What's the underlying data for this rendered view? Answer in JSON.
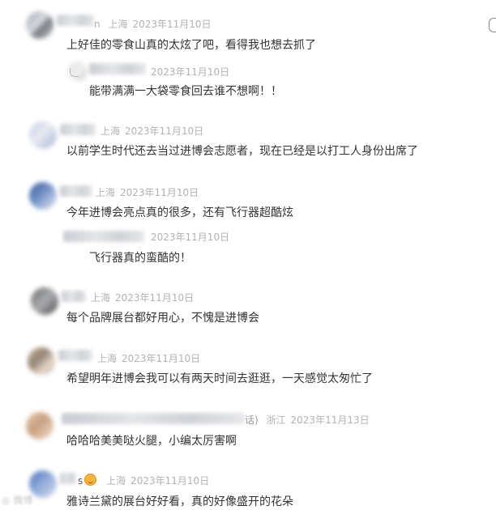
{
  "comments": [
    {
      "location": "上海",
      "date": "2023年11月10日",
      "name_suffix": "n",
      "text": "上好佳的零食山真的太炫了吧，看得我也想去抓了",
      "reply": {
        "date": "2023年11月10日",
        "text": "能带满满一大袋零食回去谁不想啊！！"
      }
    },
    {
      "location": "上海",
      "date": "2023年11月10日",
      "text": "以前学生时代还去当过进博会志愿者，现在已经是以打工人身份出席了"
    },
    {
      "location": "上海",
      "date": "2023年11月10日",
      "text": "今年进博会亮点真的很多，还有飞行器超酷炫",
      "reply": {
        "date": "2023年11月10日",
        "text": "飞行器真的蛮酷的！"
      }
    },
    {
      "location": "上海",
      "date": "2023年11月10日",
      "text": "每个品牌展台都好用心，不愧是进博会"
    },
    {
      "location": "上海",
      "date": "2023年11月10日",
      "text": "希望明年进博会我可以有两天时间去逛逛，一天感觉太匆忙了"
    },
    {
      "location": "浙江",
      "date": "2023年11月13日",
      "name_suffix": "话)",
      "text": "哈哈哈美美哒火腿，小编太厉害啊"
    },
    {
      "location": "上海",
      "date": "2023年11月10日",
      "name_suffix": "s",
      "text": "雅诗兰黛的展台好好看，真的好像盛开的花朵"
    }
  ],
  "watermark": "微博"
}
